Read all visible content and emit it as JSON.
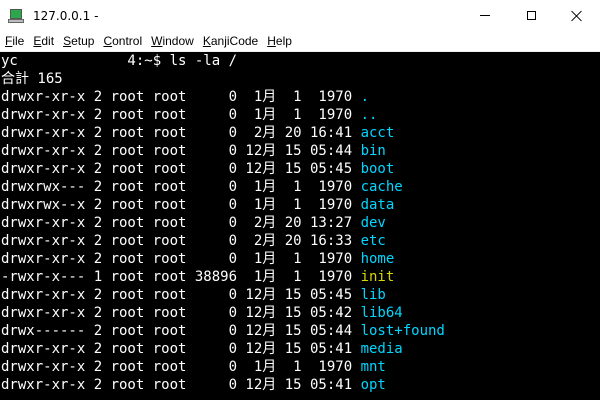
{
  "window": {
    "title": "127.0.0.1 -",
    "icon": "terminal-app-icon"
  },
  "menu": [
    {
      "label": "File",
      "accel": "F",
      "rest": "ile"
    },
    {
      "label": "Edit",
      "accel": "E",
      "rest": "dit"
    },
    {
      "label": "Setup",
      "accel": "S",
      "rest": "etup"
    },
    {
      "label": "Control",
      "accel": "C",
      "rest": "ontrol"
    },
    {
      "label": "Window",
      "accel": "W",
      "rest": "indow"
    },
    {
      "label": "KanjiCode",
      "accel": "K",
      "rest": "anjiCode"
    },
    {
      "label": "Help",
      "accel": "H",
      "rest": "elp"
    }
  ],
  "terminal": {
    "prompt": "yc             4:~$ ls -la /",
    "total": "合計 165",
    "rows": [
      {
        "perm": "drwxr-xr-x",
        "links": "2",
        "owner": "root",
        "group": "root",
        "size": "0",
        "month": "1月",
        "day": "1",
        "time": "1970",
        "name": ".",
        "kind": "dir"
      },
      {
        "perm": "drwxr-xr-x",
        "links": "2",
        "owner": "root",
        "group": "root",
        "size": "0",
        "month": "1月",
        "day": "1",
        "time": "1970",
        "name": "..",
        "kind": "dir"
      },
      {
        "perm": "drwxr-xr-x",
        "links": "2",
        "owner": "root",
        "group": "root",
        "size": "0",
        "month": "2月",
        "day": "20",
        "time": "16:41",
        "name": "acct",
        "kind": "dir"
      },
      {
        "perm": "drwxr-xr-x",
        "links": "2",
        "owner": "root",
        "group": "root",
        "size": "0",
        "month": "12月",
        "day": "15",
        "time": "05:44",
        "name": "bin",
        "kind": "dir"
      },
      {
        "perm": "drwxr-xr-x",
        "links": "2",
        "owner": "root",
        "group": "root",
        "size": "0",
        "month": "12月",
        "day": "15",
        "time": "05:45",
        "name": "boot",
        "kind": "dir"
      },
      {
        "perm": "drwxrwx---",
        "links": "2",
        "owner": "root",
        "group": "root",
        "size": "0",
        "month": "1月",
        "day": "1",
        "time": "1970",
        "name": "cache",
        "kind": "dir"
      },
      {
        "perm": "drwxrwx--x",
        "links": "2",
        "owner": "root",
        "group": "root",
        "size": "0",
        "month": "1月",
        "day": "1",
        "time": "1970",
        "name": "data",
        "kind": "dir"
      },
      {
        "perm": "drwxr-xr-x",
        "links": "2",
        "owner": "root",
        "group": "root",
        "size": "0",
        "month": "2月",
        "day": "20",
        "time": "13:27",
        "name": "dev",
        "kind": "dir"
      },
      {
        "perm": "drwxr-xr-x",
        "links": "2",
        "owner": "root",
        "group": "root",
        "size": "0",
        "month": "2月",
        "day": "20",
        "time": "16:33",
        "name": "etc",
        "kind": "dir"
      },
      {
        "perm": "drwxr-xr-x",
        "links": "2",
        "owner": "root",
        "group": "root",
        "size": "0",
        "month": "1月",
        "day": "1",
        "time": "1970",
        "name": "home",
        "kind": "dir"
      },
      {
        "perm": "-rwxr-x---",
        "links": "1",
        "owner": "root",
        "group": "root",
        "size": "38896",
        "month": "1月",
        "day": "1",
        "time": "1970",
        "name": "init",
        "kind": "exe"
      },
      {
        "perm": "drwxr-xr-x",
        "links": "2",
        "owner": "root",
        "group": "root",
        "size": "0",
        "month": "12月",
        "day": "15",
        "time": "05:45",
        "name": "lib",
        "kind": "dir"
      },
      {
        "perm": "drwxr-xr-x",
        "links": "2",
        "owner": "root",
        "group": "root",
        "size": "0",
        "month": "12月",
        "day": "15",
        "time": "05:42",
        "name": "lib64",
        "kind": "dir"
      },
      {
        "perm": "drwx------",
        "links": "2",
        "owner": "root",
        "group": "root",
        "size": "0",
        "month": "12月",
        "day": "15",
        "time": "05:44",
        "name": "lost+found",
        "kind": "dir"
      },
      {
        "perm": "drwxr-xr-x",
        "links": "2",
        "owner": "root",
        "group": "root",
        "size": "0",
        "month": "12月",
        "day": "15",
        "time": "05:41",
        "name": "media",
        "kind": "dir"
      },
      {
        "perm": "drwxr-xr-x",
        "links": "2",
        "owner": "root",
        "group": "root",
        "size": "0",
        "month": "1月",
        "day": "1",
        "time": "1970",
        "name": "mnt",
        "kind": "dir"
      },
      {
        "perm": "drwxr-xr-x",
        "links": "2",
        "owner": "root",
        "group": "root",
        "size": "0",
        "month": "12月",
        "day": "15",
        "time": "05:41",
        "name": "opt",
        "kind": "dir"
      }
    ]
  },
  "colors": {
    "background": "#000000",
    "foreground": "#ffffff",
    "directory": "#00d6ff",
    "executable": "#d6d600"
  }
}
